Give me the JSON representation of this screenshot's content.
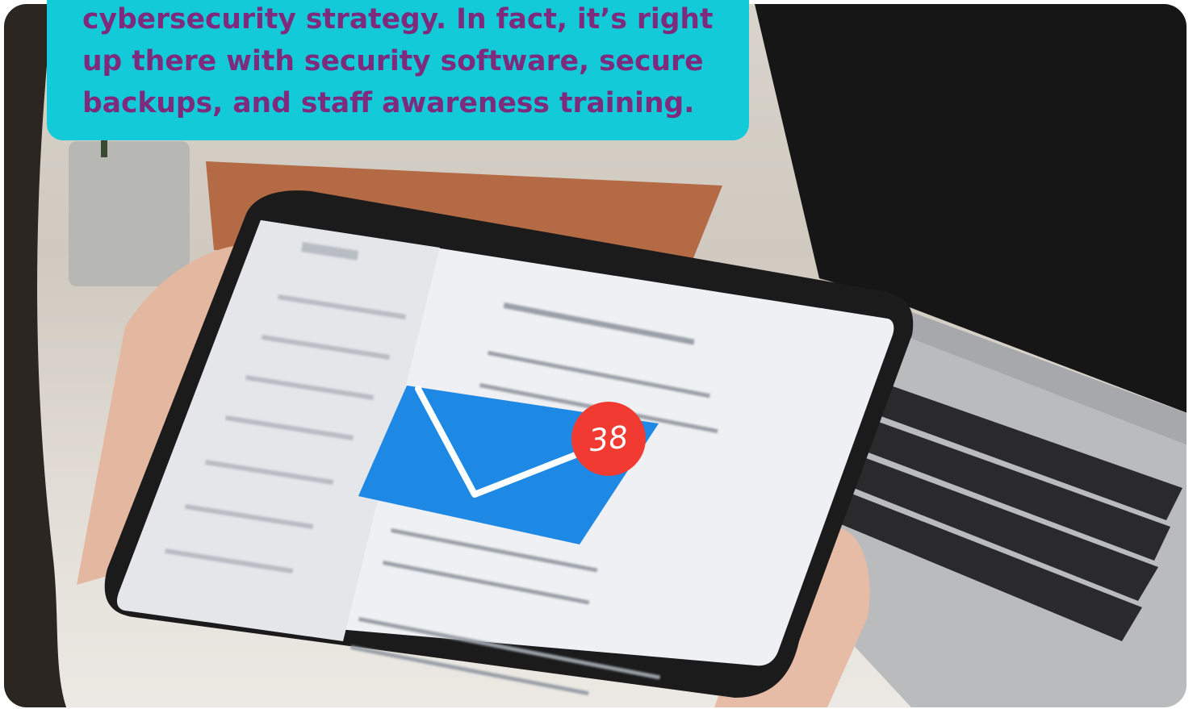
{
  "banner": {
    "lines": [
      "cybersecurity strategy. In fact, it’s right",
      "up there with security software, secure",
      "backups, and staff awareness training."
    ],
    "background_color": "#13cbd8",
    "text_color": "#7e2a7d"
  },
  "notification": {
    "icon": "envelope-icon",
    "count": "38",
    "envelope_color": "#1e88e5",
    "badge_color": "#f03a32"
  }
}
